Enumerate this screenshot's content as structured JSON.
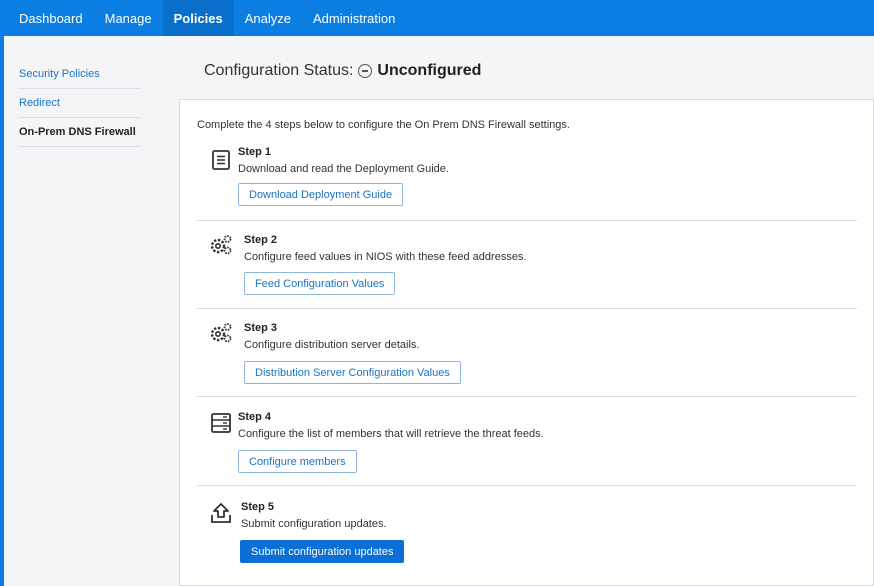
{
  "nav": {
    "items": [
      "Dashboard",
      "Manage",
      "Policies",
      "Analyze",
      "Administration"
    ],
    "active_index": 2
  },
  "sidebar": {
    "items": [
      "Security Policies",
      "Redirect",
      "On-Prem DNS Firewall"
    ],
    "active_index": 2
  },
  "header": {
    "prefix": "Configuration Status:",
    "status_icon": "minus-circle-icon",
    "status": "Unconfigured"
  },
  "intro": "Complete the 4 steps below to configure the On Prem DNS Firewall settings.",
  "steps": [
    {
      "title": "Step 1",
      "description": "Download and read the Deployment Guide.",
      "button": "Download Deployment Guide",
      "icon": "document-icon"
    },
    {
      "title": "Step 2",
      "description": "Configure feed values in NIOS with these feed addresses.",
      "button": "Feed Configuration Values",
      "icon": "gears-icon"
    },
    {
      "title": "Step 3",
      "description": "Configure distribution server details.",
      "button": "Distribution Server Configuration Values",
      "icon": "gears-icon"
    },
    {
      "title": "Step 4",
      "description": "Configure the list of members that will retrieve the threat feeds.",
      "button": "Configure members",
      "icon": "server-icon"
    },
    {
      "title": "Step 5",
      "description": "Submit configuration updates.",
      "button": "Submit configuration updates",
      "icon": "upload-tray-icon"
    }
  ],
  "colors": {
    "nav_bg": "#0b7ee3",
    "link": "#1a73c8",
    "primary_button": "#0b6fd6"
  }
}
